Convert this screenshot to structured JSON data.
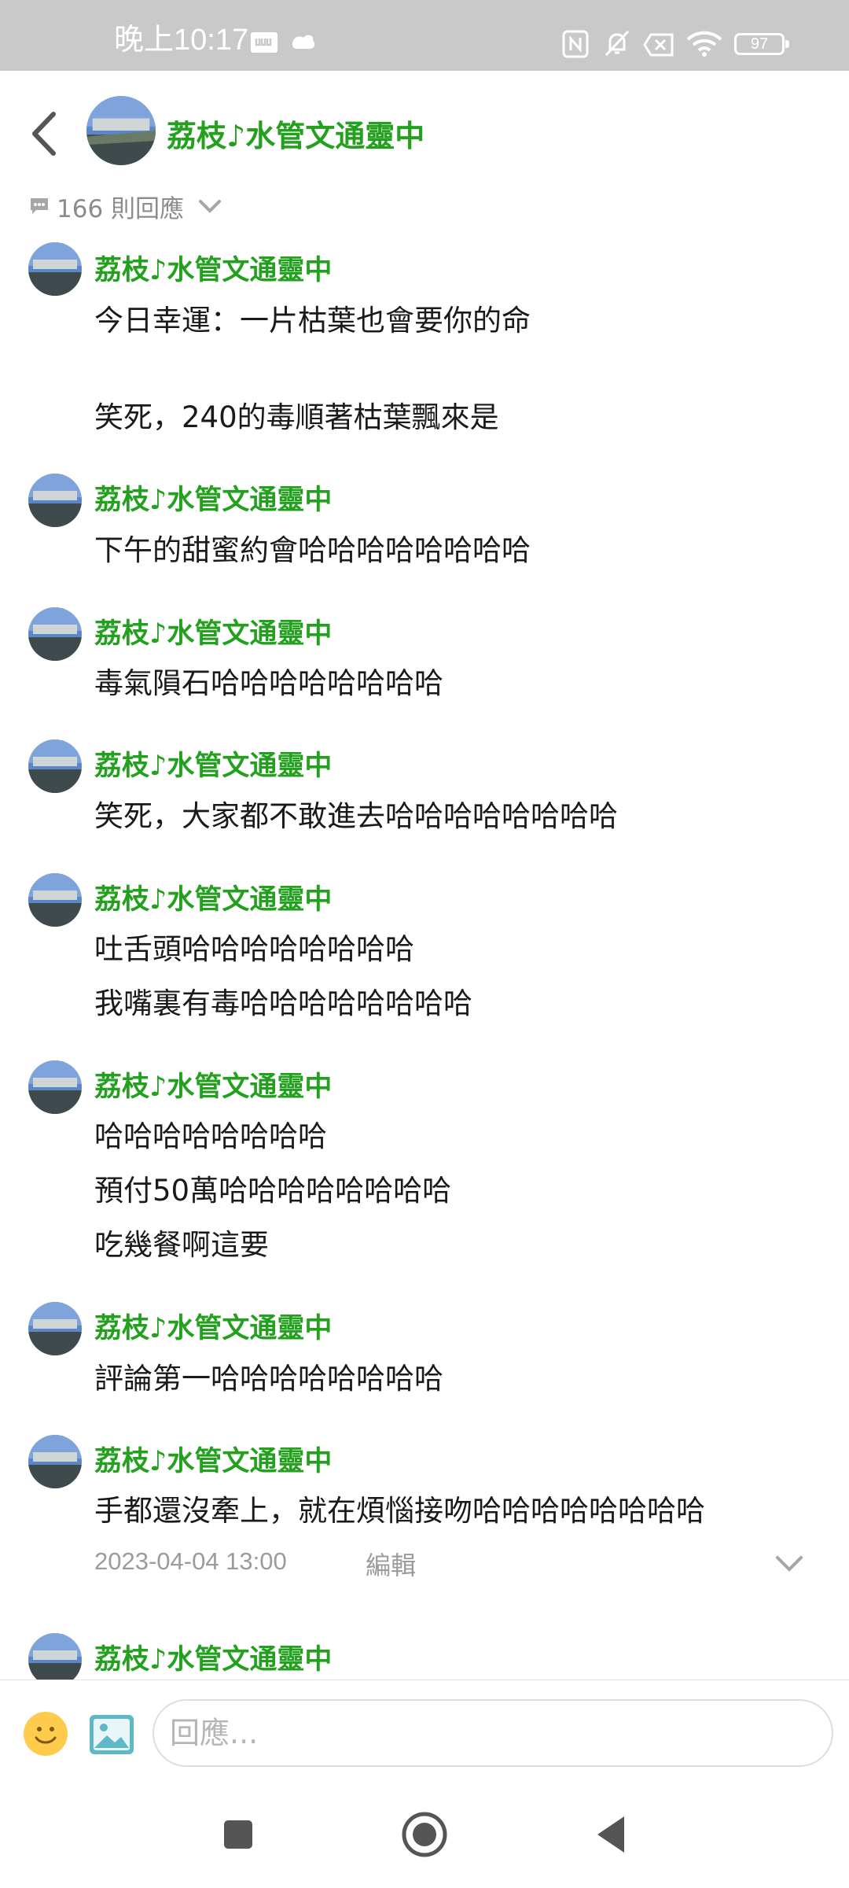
{
  "status_bar": {
    "time": "晚上10:17",
    "battery": "97"
  },
  "header": {
    "title": "荔枝♪水管文通靈中"
  },
  "reply_count": "166 則回應",
  "messages": [
    {
      "name": "荔枝♪水管文通靈中",
      "lines": [
        "今日幸運：一片枯葉也會要你的命",
        "",
        "笑死，240的毒順著枯葉飄來是"
      ]
    },
    {
      "name": "荔枝♪水管文通靈中",
      "lines": [
        "下午的甜蜜約會哈哈哈哈哈哈哈哈"
      ]
    },
    {
      "name": "荔枝♪水管文通靈中",
      "lines": [
        "毒氣隕石哈哈哈哈哈哈哈哈"
      ]
    },
    {
      "name": "荔枝♪水管文通靈中",
      "lines": [
        "笑死，大家都不敢進去哈哈哈哈哈哈哈哈"
      ]
    },
    {
      "name": "荔枝♪水管文通靈中",
      "lines": [
        "吐舌頭哈哈哈哈哈哈哈哈",
        "我嘴裏有毒哈哈哈哈哈哈哈哈"
      ]
    },
    {
      "name": "荔枝♪水管文通靈中",
      "lines": [
        "哈哈哈哈哈哈哈哈",
        "預付50萬哈哈哈哈哈哈哈哈",
        "吃幾餐啊這要"
      ]
    },
    {
      "name": "荔枝♪水管文通靈中",
      "lines": [
        "評論第一哈哈哈哈哈哈哈哈"
      ]
    },
    {
      "name": "荔枝♪水管文通靈中",
      "lines": [
        "手都還沒牽上，就在煩惱接吻哈哈哈哈哈哈哈哈"
      ],
      "timestamp": "2023-04-04 13:00",
      "edit_label": "編輯"
    },
    {
      "name": "荔枝♪水管文通靈中",
      "lines": []
    }
  ],
  "input": {
    "placeholder": "回應..."
  },
  "colors": {
    "name_green": "#23a11e",
    "status_bar": "#c9c9c9"
  }
}
